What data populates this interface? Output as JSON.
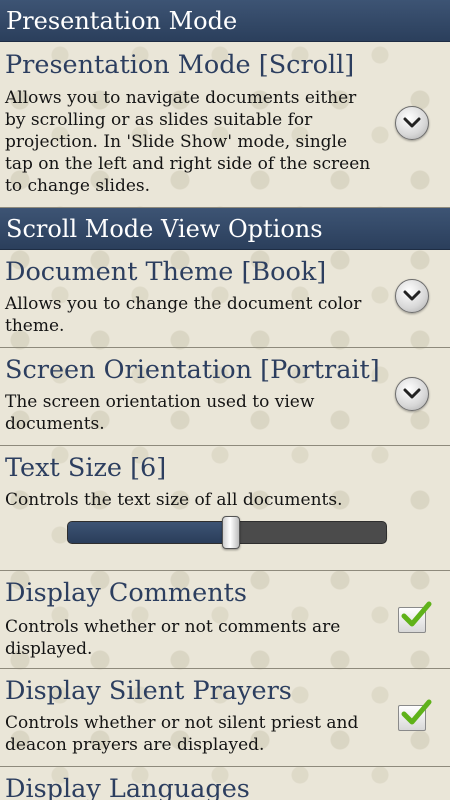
{
  "headers": {
    "presentation": "Presentation Mode",
    "scroll_view": "Scroll Mode View Options"
  },
  "presentation_mode": {
    "title": "Presentation Mode [Scroll]",
    "summary": "Allows you to navigate documents either by scrolling or as slides suitable for projection.  In 'Slide Show' mode, single tap on the left and right side of the screen to change slides."
  },
  "document_theme": {
    "title": "Document Theme [Book]",
    "summary": "Allows you to change the document color theme."
  },
  "screen_orientation": {
    "title": "Screen Orientation [Portrait]",
    "summary": "The screen orientation used to view documents."
  },
  "text_size": {
    "title": "Text Size [6]",
    "summary": "Controls the text size of all documents.",
    "slider_fraction": 0.5
  },
  "display_comments": {
    "title": "Display Comments",
    "summary": "Controls whether or not comments are displayed.",
    "checked": true
  },
  "display_silent_prayers": {
    "title": "Display Silent Prayers",
    "summary": "Controls whether or not silent priest and deacon prayers are displayed.",
    "checked": true
  },
  "display_languages": {
    "title": "Display Languages"
  },
  "icons": {
    "dropdown": "chevron-down-icon",
    "check": "checkmark-icon"
  },
  "colors": {
    "header_bg": "#2f4462",
    "title_text": "#2c3e5f",
    "check_green": "#5fb21a"
  }
}
